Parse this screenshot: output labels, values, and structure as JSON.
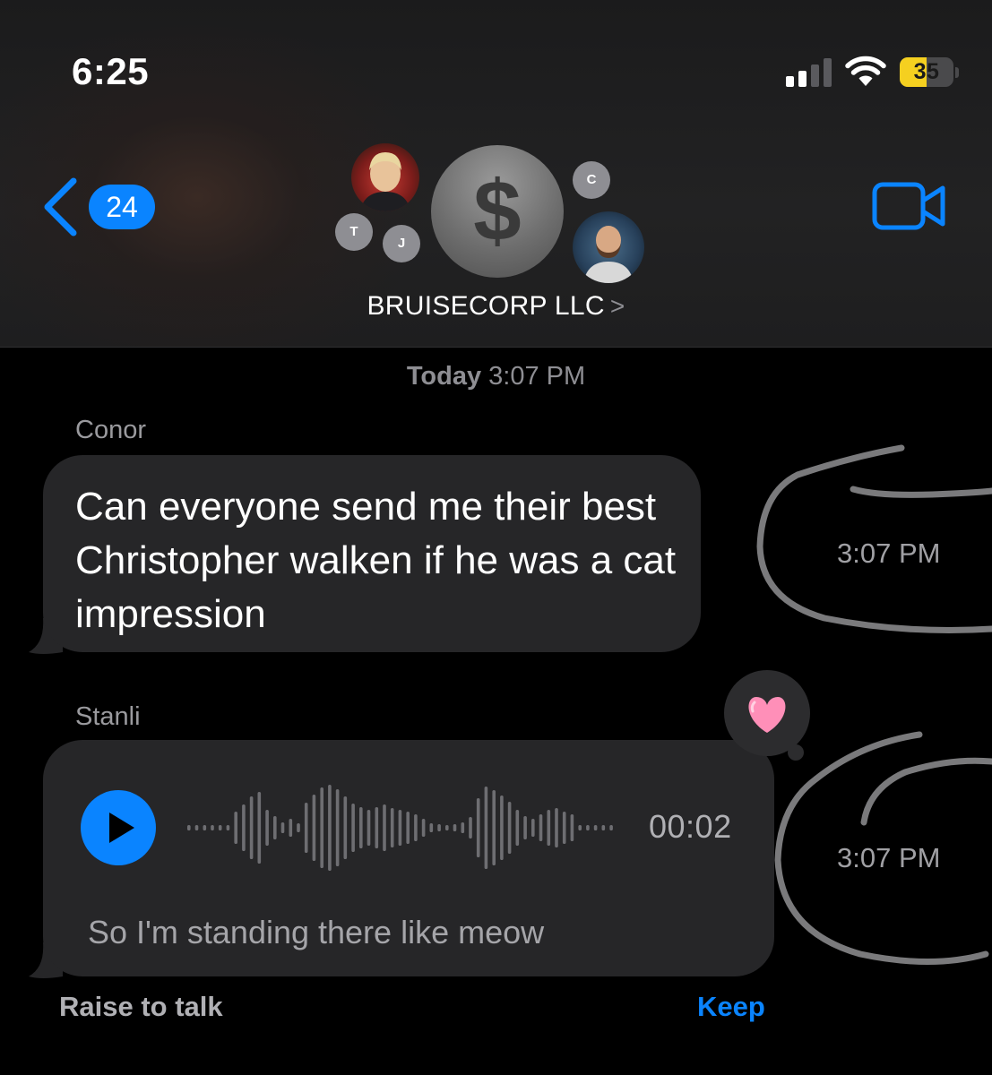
{
  "status_bar": {
    "time": "6:25",
    "battery_level": "35",
    "battery_fraction": 0.35,
    "signal_bars_active": 2,
    "signal_bars_total": 4
  },
  "nav": {
    "back_badge": "24",
    "group_name": "BRUISECORP LLC",
    "chevron": ">",
    "group_avatar_symbol": "$",
    "member_initials": [
      "T",
      "J",
      "C"
    ]
  },
  "thread": {
    "day_label": "Today",
    "day_time": "3:07 PM",
    "messages": [
      {
        "sender": "Conor",
        "text": "Can everyone send me their best Christopher walken if he was a cat impression",
        "time": "3:07 PM"
      },
      {
        "sender": "Stanli",
        "type": "audio",
        "duration": "00:02",
        "transcript": "So I'm standing there like meow",
        "reaction": "pink-heart",
        "time": "3:07 PM"
      }
    ]
  },
  "footer": {
    "raise_to_talk": "Raise to talk",
    "keep": "Keep"
  },
  "colors": {
    "accent": "#0a84ff",
    "bubble": "#262628",
    "background": "#000000",
    "battery_fill": "#f5d020"
  }
}
